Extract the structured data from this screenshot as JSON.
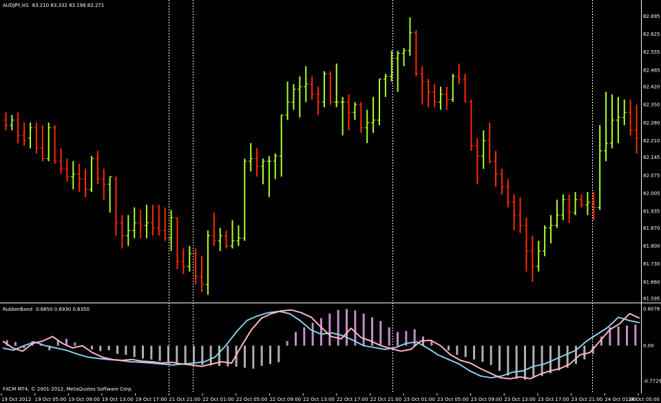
{
  "chart_header": {
    "symbol_timeframe": "AUDJPY,H1",
    "ohlc": "83.210 83.332 83.198 83.271"
  },
  "indicator_header": {
    "name": "RubberBand",
    "values": "0.6850 0.6930 0.6350"
  },
  "copyright": "FXCM MT4, © 2001-2012, MetaQuotes Software Corp.",
  "colors": {
    "background": "#000000",
    "bull_bar": "#adff2f",
    "bear_bar": "#ff2a00",
    "grid_line": "#ffffff",
    "hist_pos": "#c38fc7",
    "hist_neg": "#b0b0b0",
    "line_pink": "#ffb6c1",
    "line_blue": "#87ceeb"
  },
  "chart_data": [
    {
      "type": "ohlc",
      "symbol": "AUDJPY",
      "timeframe": "H1",
      "price_axis_labels": [
        "82.695",
        "82.625",
        "82.555",
        "82.485",
        "82.420",
        "82.350",
        "82.280",
        "82.210",
        "82.145",
        "82.075",
        "82.005",
        "81.935",
        "81.870",
        "81.800",
        "81.730",
        "81.660",
        "81.595"
      ],
      "ylim": [
        81.59,
        82.72
      ],
      "bars": [
        {
          "o": 82.29,
          "h": 82.32,
          "l": 82.25,
          "c": 82.27
        },
        {
          "o": 82.27,
          "h": 82.31,
          "l": 82.25,
          "c": 82.29
        },
        {
          "o": 82.29,
          "h": 82.32,
          "l": 82.2,
          "c": 82.23
        },
        {
          "o": 82.23,
          "h": 82.28,
          "l": 82.19,
          "c": 82.21
        },
        {
          "o": 82.22,
          "h": 82.28,
          "l": 82.18,
          "c": 82.26
        },
        {
          "o": 82.26,
          "h": 82.28,
          "l": 82.16,
          "c": 82.18
        },
        {
          "o": 82.18,
          "h": 82.27,
          "l": 82.13,
          "c": 82.14
        },
        {
          "o": 82.14,
          "h": 82.28,
          "l": 82.13,
          "c": 82.26
        },
        {
          "o": 82.26,
          "h": 82.27,
          "l": 82.12,
          "c": 82.13
        },
        {
          "o": 82.13,
          "h": 82.18,
          "l": 82.08,
          "c": 82.1
        },
        {
          "o": 82.1,
          "h": 82.14,
          "l": 82.05,
          "c": 82.07
        },
        {
          "o": 82.07,
          "h": 82.13,
          "l": 82.02,
          "c": 82.08
        },
        {
          "o": 82.08,
          "h": 82.12,
          "l": 82.01,
          "c": 82.06
        },
        {
          "o": 82.06,
          "h": 82.1,
          "l": 81.99,
          "c": 82.02
        },
        {
          "o": 82.02,
          "h": 82.15,
          "l": 82.01,
          "c": 82.14
        },
        {
          "o": 82.14,
          "h": 82.17,
          "l": 82.04,
          "c": 82.06
        },
        {
          "o": 82.06,
          "h": 82.1,
          "l": 81.98,
          "c": 82.04
        },
        {
          "o": 82.04,
          "h": 82.07,
          "l": 81.93,
          "c": 82.07
        },
        {
          "o": 82.06,
          "h": 82.07,
          "l": 81.84,
          "c": 81.89
        },
        {
          "o": 81.89,
          "h": 81.92,
          "l": 81.79,
          "c": 81.84
        },
        {
          "o": 81.84,
          "h": 81.92,
          "l": 81.8,
          "c": 81.86
        },
        {
          "o": 81.86,
          "h": 81.95,
          "l": 81.83,
          "c": 81.89
        },
        {
          "o": 81.89,
          "h": 81.94,
          "l": 81.83,
          "c": 81.88
        },
        {
          "o": 81.88,
          "h": 81.96,
          "l": 81.83,
          "c": 81.89
        },
        {
          "o": 81.89,
          "h": 81.96,
          "l": 81.84,
          "c": 81.87
        },
        {
          "o": 81.87,
          "h": 81.96,
          "l": 81.84,
          "c": 81.86
        },
        {
          "o": 81.86,
          "h": 81.95,
          "l": 81.82,
          "c": 81.83
        },
        {
          "o": 81.83,
          "h": 81.94,
          "l": 81.78,
          "c": 81.91
        },
        {
          "o": 81.91,
          "h": 81.91,
          "l": 81.71,
          "c": 81.74
        },
        {
          "o": 81.74,
          "h": 81.79,
          "l": 81.69,
          "c": 81.72
        },
        {
          "o": 81.72,
          "h": 81.8,
          "l": 81.7,
          "c": 81.77
        },
        {
          "o": 81.77,
          "h": 81.79,
          "l": 81.65,
          "c": 81.68
        },
        {
          "o": 81.68,
          "h": 81.76,
          "l": 81.62,
          "c": 81.65
        },
        {
          "o": 81.65,
          "h": 81.86,
          "l": 81.61,
          "c": 81.84
        },
        {
          "o": 81.84,
          "h": 81.93,
          "l": 81.8,
          "c": 81.82
        },
        {
          "o": 81.82,
          "h": 81.87,
          "l": 81.78,
          "c": 81.84
        },
        {
          "o": 81.84,
          "h": 81.86,
          "l": 81.79,
          "c": 81.8
        },
        {
          "o": 81.8,
          "h": 81.9,
          "l": 81.79,
          "c": 81.82
        },
        {
          "o": 81.82,
          "h": 81.88,
          "l": 81.8,
          "c": 81.83
        },
        {
          "o": 81.83,
          "h": 82.14,
          "l": 81.82,
          "c": 82.13
        },
        {
          "o": 82.13,
          "h": 82.2,
          "l": 82.09,
          "c": 82.14
        },
        {
          "o": 82.14,
          "h": 82.18,
          "l": 82.07,
          "c": 82.11
        },
        {
          "o": 82.11,
          "h": 82.14,
          "l": 82.04,
          "c": 82.13
        },
        {
          "o": 82.13,
          "h": 82.15,
          "l": 81.99,
          "c": 82.13
        },
        {
          "o": 82.13,
          "h": 82.16,
          "l": 82.06,
          "c": 82.15
        },
        {
          "o": 82.15,
          "h": 82.31,
          "l": 82.07,
          "c": 82.31
        },
        {
          "o": 82.31,
          "h": 82.44,
          "l": 82.29,
          "c": 82.36
        },
        {
          "o": 82.36,
          "h": 82.43,
          "l": 82.33,
          "c": 82.41
        },
        {
          "o": 82.41,
          "h": 82.46,
          "l": 82.3,
          "c": 82.42
        },
        {
          "o": 82.42,
          "h": 82.5,
          "l": 82.36,
          "c": 82.43
        },
        {
          "o": 82.43,
          "h": 82.46,
          "l": 82.37,
          "c": 82.39
        },
        {
          "o": 82.39,
          "h": 82.42,
          "l": 82.31,
          "c": 82.36
        },
        {
          "o": 82.36,
          "h": 82.48,
          "l": 82.34,
          "c": 82.47
        },
        {
          "o": 82.47,
          "h": 82.48,
          "l": 82.35,
          "c": 82.36
        },
        {
          "o": 82.36,
          "h": 82.51,
          "l": 82.34,
          "c": 82.36
        },
        {
          "o": 82.36,
          "h": 82.38,
          "l": 82.23,
          "c": 82.36
        },
        {
          "o": 82.36,
          "h": 82.39,
          "l": 82.25,
          "c": 82.32
        },
        {
          "o": 82.32,
          "h": 82.36,
          "l": 82.29,
          "c": 82.35
        },
        {
          "o": 82.35,
          "h": 82.36,
          "l": 82.24,
          "c": 82.26
        },
        {
          "o": 82.26,
          "h": 82.33,
          "l": 82.2,
          "c": 82.28
        },
        {
          "o": 82.28,
          "h": 82.38,
          "l": 82.24,
          "c": 82.29
        },
        {
          "o": 82.29,
          "h": 82.45,
          "l": 82.27,
          "c": 82.45
        },
        {
          "o": 82.45,
          "h": 82.47,
          "l": 82.38,
          "c": 82.46
        },
        {
          "o": 82.46,
          "h": 82.56,
          "l": 82.44,
          "c": 82.53
        },
        {
          "o": 82.53,
          "h": 82.56,
          "l": 82.4,
          "c": 82.55
        },
        {
          "o": 82.55,
          "h": 82.57,
          "l": 82.5,
          "c": 82.56
        },
        {
          "o": 82.56,
          "h": 82.69,
          "l": 82.54,
          "c": 82.63
        },
        {
          "o": 82.63,
          "h": 82.64,
          "l": 82.46,
          "c": 82.47
        },
        {
          "o": 82.47,
          "h": 82.5,
          "l": 82.35,
          "c": 82.44
        },
        {
          "o": 82.44,
          "h": 82.45,
          "l": 82.34,
          "c": 82.4
        },
        {
          "o": 82.4,
          "h": 82.43,
          "l": 82.34,
          "c": 82.36
        },
        {
          "o": 82.36,
          "h": 82.42,
          "l": 82.33,
          "c": 82.39
        },
        {
          "o": 82.39,
          "h": 82.42,
          "l": 82.33,
          "c": 82.37
        },
        {
          "o": 82.37,
          "h": 82.47,
          "l": 82.36,
          "c": 82.46
        },
        {
          "o": 82.46,
          "h": 82.51,
          "l": 82.43,
          "c": 82.45
        },
        {
          "o": 82.45,
          "h": 82.47,
          "l": 82.36,
          "c": 82.36
        },
        {
          "o": 82.36,
          "h": 82.37,
          "l": 82.17,
          "c": 82.19
        },
        {
          "o": 82.19,
          "h": 82.22,
          "l": 82.04,
          "c": 82.15
        },
        {
          "o": 82.15,
          "h": 82.25,
          "l": 82.1,
          "c": 82.21
        },
        {
          "o": 82.21,
          "h": 82.28,
          "l": 82.12,
          "c": 82.13
        },
        {
          "o": 82.13,
          "h": 82.17,
          "l": 82.03,
          "c": 82.08
        },
        {
          "o": 82.08,
          "h": 82.1,
          "l": 82.0,
          "c": 82.03
        },
        {
          "o": 82.03,
          "h": 82.06,
          "l": 81.95,
          "c": 81.97
        },
        {
          "o": 81.97,
          "h": 82.0,
          "l": 81.86,
          "c": 81.92
        },
        {
          "o": 81.92,
          "h": 81.99,
          "l": 81.85,
          "c": 81.88
        },
        {
          "o": 81.88,
          "h": 81.91,
          "l": 81.7,
          "c": 81.78
        },
        {
          "o": 81.78,
          "h": 81.84,
          "l": 81.66,
          "c": 81.72
        },
        {
          "o": 81.72,
          "h": 81.82,
          "l": 81.7,
          "c": 81.78
        },
        {
          "o": 81.78,
          "h": 81.88,
          "l": 81.76,
          "c": 81.87
        },
        {
          "o": 81.87,
          "h": 81.92,
          "l": 81.81,
          "c": 81.88
        },
        {
          "o": 81.88,
          "h": 81.98,
          "l": 81.87,
          "c": 81.92
        },
        {
          "o": 81.92,
          "h": 82.0,
          "l": 81.9,
          "c": 81.98
        },
        {
          "o": 81.98,
          "h": 82.0,
          "l": 81.89,
          "c": 81.93
        },
        {
          "o": 81.93,
          "h": 82.01,
          "l": 81.92,
          "c": 81.98
        },
        {
          "o": 81.98,
          "h": 82.0,
          "l": 81.95,
          "c": 81.96
        },
        {
          "o": 81.96,
          "h": 82.01,
          "l": 81.92,
          "c": 81.97
        },
        {
          "o": 81.97,
          "h": 82.01,
          "l": 81.9,
          "c": 81.95
        },
        {
          "o": 81.95,
          "h": 82.27,
          "l": 81.94,
          "c": 82.17
        },
        {
          "o": 82.17,
          "h": 82.4,
          "l": 82.13,
          "c": 82.2
        },
        {
          "o": 82.2,
          "h": 82.39,
          "l": 82.18,
          "c": 82.29
        },
        {
          "o": 82.29,
          "h": 82.38,
          "l": 82.2,
          "c": 82.3
        },
        {
          "o": 82.3,
          "h": 82.37,
          "l": 82.27,
          "c": 82.32
        },
        {
          "o": 82.32,
          "h": 82.37,
          "l": 82.23,
          "c": 82.25
        },
        {
          "o": 82.25,
          "h": 82.35,
          "l": 82.16,
          "c": 82.22
        }
      ]
    },
    {
      "type": "histogram_with_lines",
      "name": "RubberBand",
      "level_labels": [
        "0.8076",
        "0.00",
        "-0.7729"
      ],
      "ylim": [
        -0.8,
        0.82
      ],
      "histogram": [
        0.12,
        0.08,
        -0.05,
        0.1,
        0.05,
        -0.1,
        0.12,
        0.15,
        0.07,
        0.0,
        -0.08,
        -0.12,
        -0.1,
        -0.18,
        -0.2,
        -0.25,
        -0.28,
        -0.3,
        -0.33,
        -0.35,
        -0.36,
        -0.38,
        -0.4,
        -0.42,
        -0.43,
        -0.44,
        -0.45,
        -0.46,
        -0.48,
        -0.5,
        -0.44,
        -0.4,
        -0.36,
        0.1,
        0.3,
        0.4,
        0.5,
        0.6,
        0.7,
        0.78,
        0.8,
        0.77,
        0.7,
        0.62,
        0.54,
        0.4,
        0.3,
        0.32,
        0.36,
        0.2,
        0.1,
        0.0,
        -0.1,
        -0.2,
        -0.25,
        -0.3,
        -0.35,
        -0.42,
        -0.55,
        -0.65,
        -0.72,
        -0.74,
        -0.7,
        -0.66,
        -0.6,
        -0.54,
        -0.48,
        -0.4,
        -0.3,
        -0.18,
        0.2,
        0.4,
        0.42,
        0.44,
        0.46
      ],
      "line_pink": [
        0.1,
        -0.05,
        -0.12,
        0.05,
        0.1,
        0.2,
        0.05,
        -0.05,
        0.0,
        -0.15,
        -0.25,
        -0.3,
        -0.32,
        -0.3,
        -0.34,
        -0.35,
        -0.38,
        -0.36,
        -0.4,
        -0.42,
        -0.45,
        -0.4,
        -0.35,
        -0.38,
        0.0,
        0.35,
        0.6,
        0.7,
        0.76,
        0.78,
        0.72,
        0.62,
        0.4,
        0.2,
        0.15,
        0.38,
        0.18,
        0.1,
        0.0,
        -0.06,
        -0.12,
        -0.08,
        0.1,
        0.12,
        0.0,
        -0.2,
        -0.32,
        -0.38,
        -0.5,
        -0.6,
        -0.7,
        -0.72,
        -0.68,
        -0.72,
        -0.62,
        -0.55,
        -0.5,
        -0.4,
        -0.2,
        -0.15,
        0.1,
        0.35,
        0.48,
        0.7,
        0.6
      ],
      "line_blue": [
        -0.05,
        -0.1,
        0.0,
        0.08,
        0.0,
        -0.05,
        -0.1,
        -0.18,
        -0.25,
        -0.28,
        -0.3,
        -0.32,
        -0.35,
        -0.36,
        -0.38,
        -0.4,
        -0.42,
        -0.4,
        -0.38,
        -0.35,
        -0.25,
        0.0,
        0.3,
        0.55,
        0.65,
        0.72,
        0.75,
        0.7,
        0.55,
        0.35,
        0.25,
        0.28,
        0.22,
        0.12,
        0.0,
        -0.04,
        -0.08,
        -0.04,
        0.05,
        0.08,
        -0.05,
        -0.2,
        -0.3,
        -0.4,
        -0.55,
        -0.66,
        -0.7,
        -0.66,
        -0.58,
        -0.55,
        -0.45,
        -0.4,
        -0.3,
        -0.2,
        -0.1,
        0.1,
        0.25,
        0.4,
        0.62,
        0.55,
        0.5
      ]
    }
  ],
  "time_axis_labels": [
    "19 Oct 2012",
    "19 Oct 05:00",
    "19 Oct 09:00",
    "19 Oct 13:00",
    "19 Oct 17:00",
    "21 Oct 21:00",
    "22 Oct 01:00",
    "22 Oct 05:00",
    "22 Oct 09:00",
    "22 Oct 13:00",
    "22 Oct 17:00",
    "22 Oct 21:00",
    "23 Oct 01:00",
    "23 Oct 05:00",
    "23 Oct 09:00",
    "23 Oct 13:00",
    "23 Oct 17:00",
    "23 Oct 21:00",
    "24 Oct 01:00",
    "24 Oct 05:00"
  ]
}
